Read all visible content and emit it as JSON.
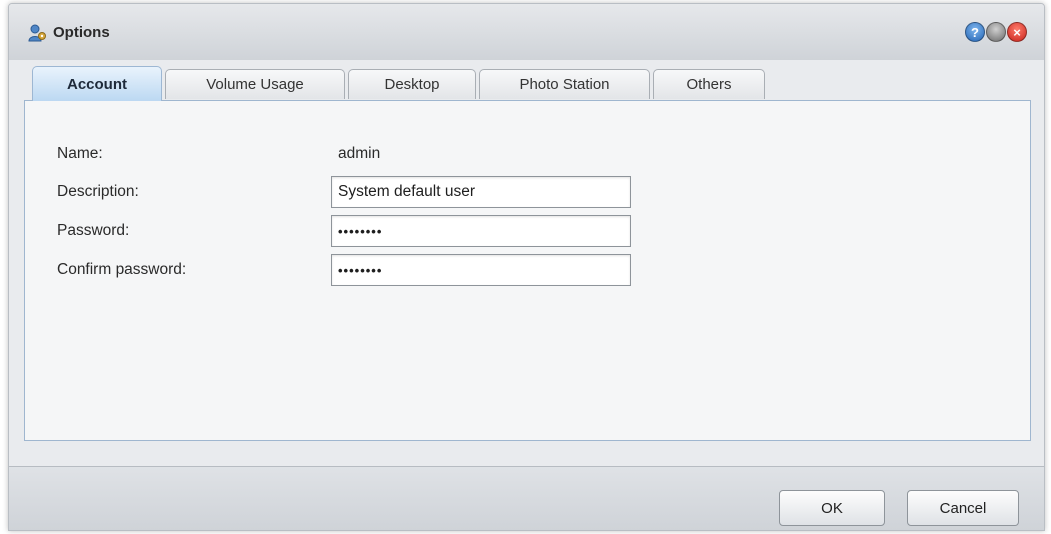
{
  "window": {
    "title": "Options",
    "help_symbol": "?",
    "close_symbol": "×"
  },
  "tabs": [
    {
      "label": "Account",
      "active": true
    },
    {
      "label": "Volume Usage",
      "active": false
    },
    {
      "label": "Desktop",
      "active": false
    },
    {
      "label": "Photo Station",
      "active": false
    },
    {
      "label": "Others",
      "active": false
    }
  ],
  "form": {
    "name_label": "Name:",
    "name_value": "admin",
    "description_label": "Description:",
    "description_value": "System default user",
    "password_label": "Password:",
    "password_value": "••••••••",
    "confirm_label": "Confirm password:",
    "confirm_value": "••••••••"
  },
  "footer": {
    "ok_label": "OK",
    "cancel_label": "Cancel"
  },
  "colors": {
    "active_tab": "#bcd8f2",
    "panel_border": "#9fb6cf",
    "close_button": "#c7231c",
    "help_button": "#2364b4"
  },
  "icons": {
    "title_icon": "user-settings-icon",
    "help": "help-icon",
    "minimize": "minimize-icon",
    "close": "close-icon"
  }
}
